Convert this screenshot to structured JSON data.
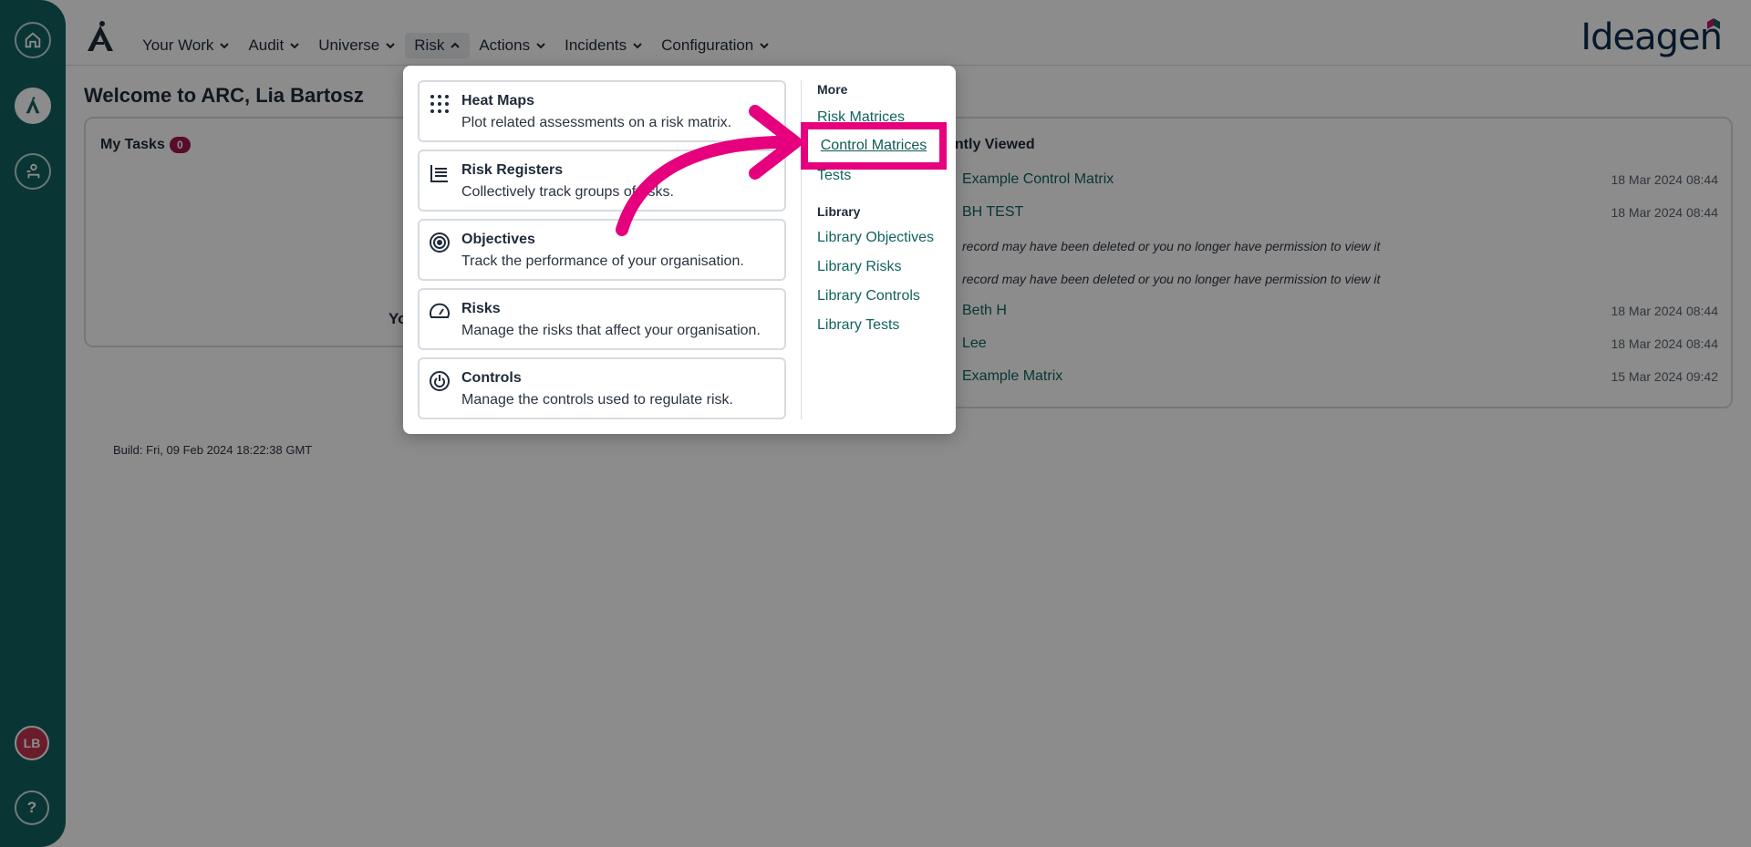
{
  "nav": {
    "items": [
      {
        "label": "Your Work"
      },
      {
        "label": "Audit"
      },
      {
        "label": "Universe"
      },
      {
        "label": "Risk"
      },
      {
        "label": "Actions"
      },
      {
        "label": "Incidents"
      },
      {
        "label": "Configuration"
      }
    ],
    "brand": "Ideagen"
  },
  "rail": {
    "avatar_initials": "LB",
    "help_label": "?"
  },
  "welcome": "Welcome to ARC, Lia Bartosz",
  "tasks": {
    "title": "My Tasks",
    "count": "0",
    "empty_partial": "Yo"
  },
  "recent": {
    "title_partial": "ently Viewed",
    "items": [
      {
        "label": "Example Control Matrix",
        "date": "18 Mar 2024 08:44"
      },
      {
        "label": "BH TEST",
        "date": "18 Mar 2024 08:44"
      },
      {
        "note": "record may have been deleted or you no longer have permission to view it"
      },
      {
        "note": "record may have been deleted or you no longer have permission to view it"
      },
      {
        "label": "Beth H",
        "date": "18 Mar 2024 08:44"
      },
      {
        "label": "Lee",
        "date": "18 Mar 2024 08:44"
      },
      {
        "label": "Example Matrix",
        "date": "15 Mar 2024 09:42"
      }
    ]
  },
  "build": "Build: Fri, 09 Feb 2024 18:22:38 GMT",
  "menu": {
    "cards": [
      {
        "title": "Heat Maps",
        "desc": "Plot related assessments on a risk matrix."
      },
      {
        "title": "Risk Registers",
        "desc": "Collectively track groups of risks."
      },
      {
        "title": "Objectives",
        "desc": "Track the performance of your organisation."
      },
      {
        "title": "Risks",
        "desc": "Manage the risks that affect your organisation."
      },
      {
        "title": "Controls",
        "desc": "Manage the controls used to regulate risk."
      }
    ],
    "more_heading": "More",
    "more_links": [
      "Risk Matrices",
      "Control Matrices",
      "Tests"
    ],
    "library_heading": "Library",
    "library_links": [
      "Library Objectives",
      "Library Risks",
      "Library Controls",
      "Library Tests"
    ]
  },
  "colors": {
    "rail": "#12635f",
    "link": "#12635f",
    "highlight": "#e6007e",
    "badge": "#a3154b"
  }
}
